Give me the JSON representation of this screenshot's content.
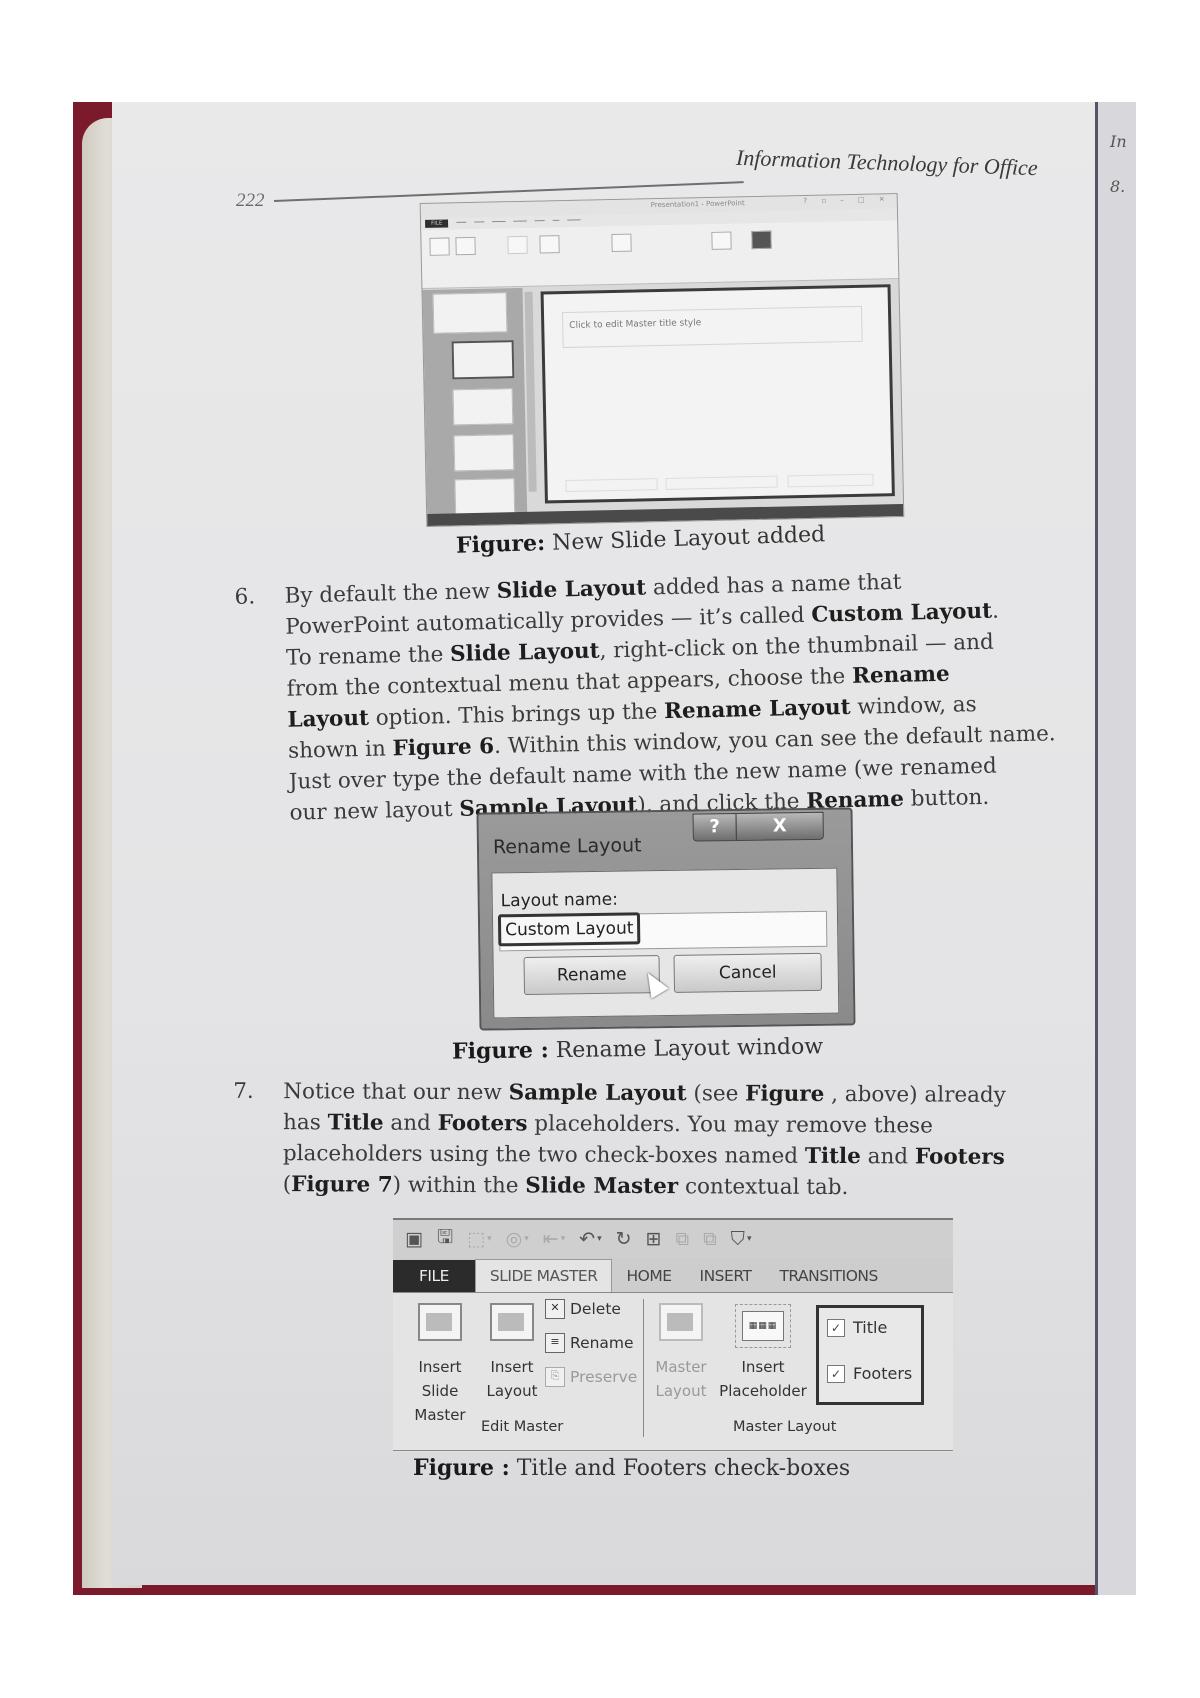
{
  "page": {
    "number": "222",
    "running_title": "Information Technology for Office",
    "next_page_fragments": [
      "In",
      "8."
    ]
  },
  "figure1": {
    "window_title": "Presentation1 - PowerPoint",
    "file_tab": "FILE",
    "slide_placeholder": "Click to edit Master title style",
    "caption_label": "Figure:",
    "caption_text": " New Slide Layout added"
  },
  "para6": {
    "number": "6.",
    "lines": [
      [
        "By default the new ",
        {
          "b": "Slide Layout"
        },
        " added has a name that"
      ],
      [
        "PowerPoint automatically provides — it’s called ",
        {
          "b": "Custom Layout"
        },
        "."
      ],
      [
        "To rename the ",
        {
          "b": "Slide Layout"
        },
        ", right-click on the thumbnail — and"
      ],
      [
        "from the contextual menu that appears, choose the ",
        {
          "b": "Rename"
        }
      ],
      [
        {
          "b": "Layout"
        },
        " option. This brings up the ",
        {
          "b": "Rename Layout"
        },
        " window, as"
      ],
      [
        "shown in ",
        {
          "b": "Figure 6"
        },
        ". Within this window, you can see the default name."
      ],
      [
        "Just over type the default name with the new name (we renamed"
      ],
      [
        "our new layout ",
        {
          "b": "Sample Layout"
        },
        "), and click the ",
        {
          "b": "Rename"
        },
        " button."
      ]
    ]
  },
  "dialog": {
    "title": "Rename Layout",
    "help_label": "?",
    "close_label": "X",
    "field_label": "Layout name:",
    "field_value": "Custom Layout",
    "rename_label": "Rename",
    "cancel_label": "Cancel"
  },
  "figure2": {
    "caption_label": "Figure :",
    "caption_text": " Rename Layout window"
  },
  "para7": {
    "number": "7.",
    "lines": [
      [
        "Notice that our new ",
        {
          "b": "Sample Layout"
        },
        " (see ",
        {
          "b": "Figure"
        },
        " , above) already"
      ],
      [
        "has ",
        {
          "b": "Title"
        },
        " and ",
        {
          "b": "Footers"
        },
        " placeholders. You may remove these"
      ],
      [
        "placeholders using the two check-boxes named ",
        {
          "b": "Title"
        },
        " and ",
        {
          "b": "Footers"
        }
      ],
      [
        "(",
        {
          "b": "Figure 7"
        },
        ") within the ",
        {
          "b": "Slide Master"
        },
        " contextual tab."
      ]
    ]
  },
  "ribbon": {
    "qat_icons": [
      "powerpoint-app-icon",
      "save-icon",
      "shape-icon",
      "shape-fill-icon",
      "arrange-icon",
      "undo-icon",
      "redo-icon",
      "select-icon",
      "group-icon",
      "ungroup-icon",
      "format-painter-icon"
    ],
    "tabs": [
      "FILE",
      "SLIDE MASTER",
      "HOME",
      "INSERT",
      "TRANSITIONS"
    ],
    "active_tab": "SLIDE MASTER",
    "edit_master": {
      "group_label": "Edit Master",
      "insert_slide_master": [
        "Insert Slide",
        "Master"
      ],
      "insert_layout": [
        "Insert",
        "Layout"
      ],
      "delete": "Delete",
      "rename": "Rename",
      "preserve": "Preserve"
    },
    "master_layout": {
      "group_label": "Master Layout",
      "master_layout_btn": [
        "Master",
        "Layout"
      ],
      "insert_placeholder": [
        "Insert",
        "Placeholder"
      ],
      "title_checkbox": {
        "label": "Title",
        "checked": true
      },
      "footers_checkbox": {
        "label": "Footers",
        "checked": true
      }
    }
  },
  "figure3": {
    "caption_label": "Figure :",
    "caption_text": " Title and Footers check-boxes"
  }
}
